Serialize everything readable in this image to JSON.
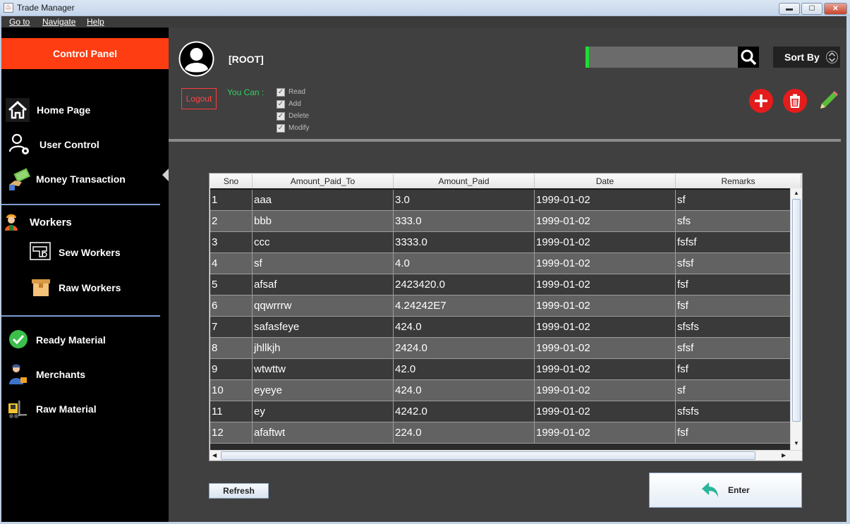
{
  "window": {
    "title": "Trade Manager",
    "minimize": "▬",
    "maximize": "☐",
    "close": "✕"
  },
  "menubar": [
    "Go to",
    "Navigate",
    "Help"
  ],
  "sidebar": {
    "header": "Control Panel",
    "items": [
      {
        "label": "Home Page",
        "icon": "home-icon"
      },
      {
        "label": "User Control",
        "icon": "user-settings-icon"
      },
      {
        "label": "Money Transaction",
        "icon": "money-icon"
      },
      {
        "label": "Workers",
        "icon": "worker-icon"
      },
      {
        "label": "Sew Workers",
        "icon": "sewing-machine-icon"
      },
      {
        "label": "Raw Workers",
        "icon": "box-icon"
      },
      {
        "label": "Ready Material",
        "icon": "check-circle-icon"
      },
      {
        "label": "Merchants",
        "icon": "merchant-icon"
      },
      {
        "label": "Raw Material",
        "icon": "forklift-icon"
      }
    ]
  },
  "user": {
    "name": "[ROOT]",
    "logout": "Logout",
    "you_can": "You Can :",
    "permissions": [
      "Read",
      "Add",
      "Delete",
      "Modify"
    ]
  },
  "toolbar": {
    "search_value": "",
    "sort_label": "Sort By"
  },
  "table": {
    "columns": [
      "Sno",
      "Amount_Paid_To",
      "Amount_Paid",
      "Date",
      "Remarks"
    ],
    "rows": [
      [
        "1",
        "aaa",
        "3.0",
        "1999-01-02",
        "sf"
      ],
      [
        "2",
        "bbb",
        "333.0",
        "1999-01-02",
        "sfs"
      ],
      [
        "3",
        "ccc",
        "3333.0",
        "1999-01-02",
        "fsfsf"
      ],
      [
        "4",
        "sf",
        "4.0",
        "1999-01-02",
        "sfsf"
      ],
      [
        "5",
        "afsaf",
        "2423420.0",
        "1999-01-02",
        "fsf"
      ],
      [
        "6",
        "qqwrrrw",
        "4.24242E7",
        "1999-01-02",
        "fsf"
      ],
      [
        "7",
        "safasfeye",
        "424.0",
        "1999-01-02",
        "sfsfs"
      ],
      [
        "8",
        "jhllkjh",
        "2424.0",
        "1999-01-02",
        "sfsf"
      ],
      [
        "9",
        "wtwttw",
        "42.0",
        "1999-01-02",
        "fsf"
      ],
      [
        "10",
        "eyeye",
        "424.0",
        "1999-01-02",
        "sf"
      ],
      [
        "11",
        "ey",
        "4242.0",
        "1999-01-02",
        "sfsfs"
      ],
      [
        "12",
        "afaftwt",
        "224.0",
        "1999-01-02",
        "fsf"
      ]
    ]
  },
  "buttons": {
    "refresh": "Refresh",
    "enter": "Enter"
  },
  "colors": {
    "accent": "#ff3d12",
    "green": "#1edc35",
    "panel": "#404040",
    "sidebar": "#000000"
  }
}
